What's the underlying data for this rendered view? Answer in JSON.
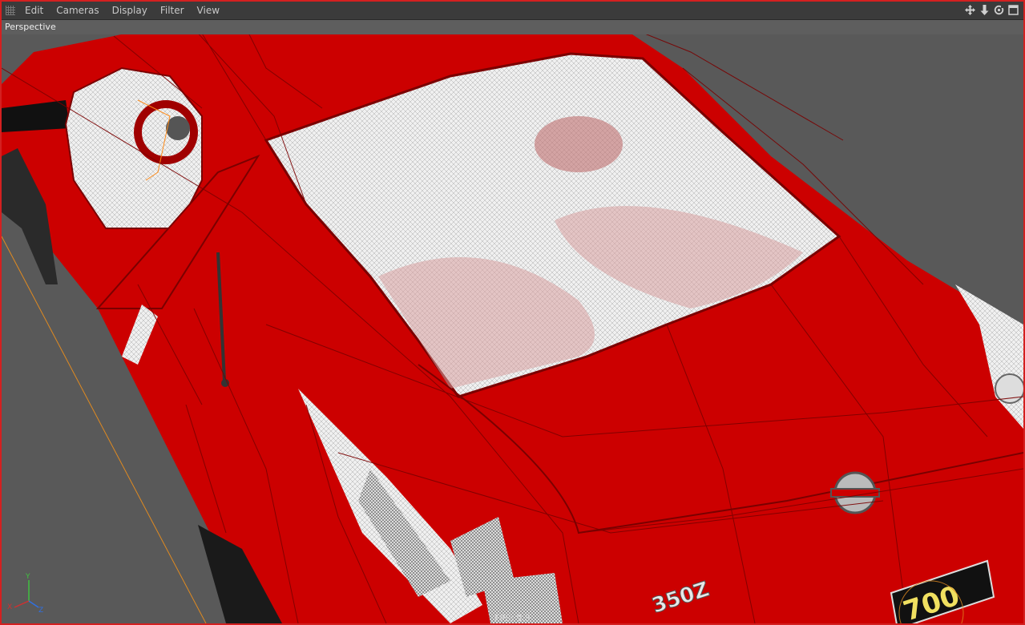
{
  "menubar": {
    "items": [
      {
        "label": "Edit",
        "name": "menu-edit"
      },
      {
        "label": "Cameras",
        "name": "menu-cameras"
      },
      {
        "label": "Display",
        "name": "menu-display"
      },
      {
        "label": "Filter",
        "name": "menu-filter"
      },
      {
        "label": "View",
        "name": "menu-view"
      }
    ],
    "tools": [
      "move-view-icon",
      "dolly-icon",
      "rotate-view-icon",
      "maximize-view-icon"
    ]
  },
  "viewport": {
    "label": "Perspective",
    "fps_text": "FPS: 9.5"
  },
  "axis": {
    "x": "X",
    "y": "Y",
    "z": "Z"
  },
  "scene": {
    "badge_text": "350Z",
    "plate_text": "700",
    "colors": {
      "body": "#cc0000",
      "wire": "#7a0000",
      "glass": "#f2f2f2",
      "background": "#595959",
      "horizon_line": "#e08a20"
    }
  }
}
